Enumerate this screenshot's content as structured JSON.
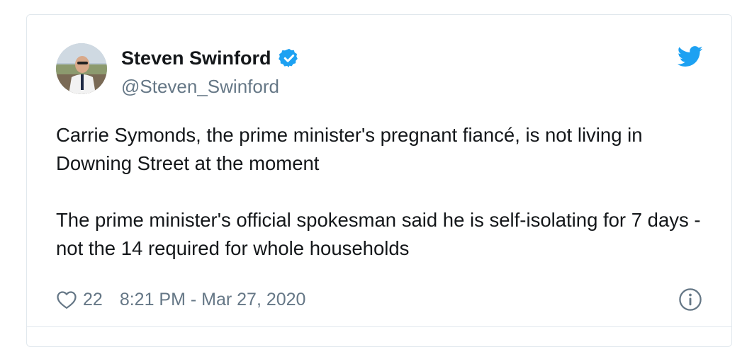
{
  "tweet": {
    "author_name": "Steven Swinford",
    "author_handle": "@Steven_Swinford",
    "verified": true,
    "text_paragraph_1": "Carrie Symonds, the prime minister's pregnant fiancé,  is not living in Downing Street at the moment",
    "text_paragraph_2": "The prime minister's official spokesman said he is self-isolating for 7 days - not the 14 required for whole households",
    "like_count": "22",
    "timestamp": "8:21 PM - Mar 27, 2020"
  },
  "icons": {
    "avatar": "avatar",
    "verified": "verified-badge-icon",
    "brand": "twitter-bird-icon",
    "like": "heart-icon",
    "info": "info-icon"
  },
  "colors": {
    "twitter_blue": "#1da1f2",
    "text_primary": "#14171a",
    "text_secondary": "#657786",
    "border": "#e1e8ed"
  }
}
